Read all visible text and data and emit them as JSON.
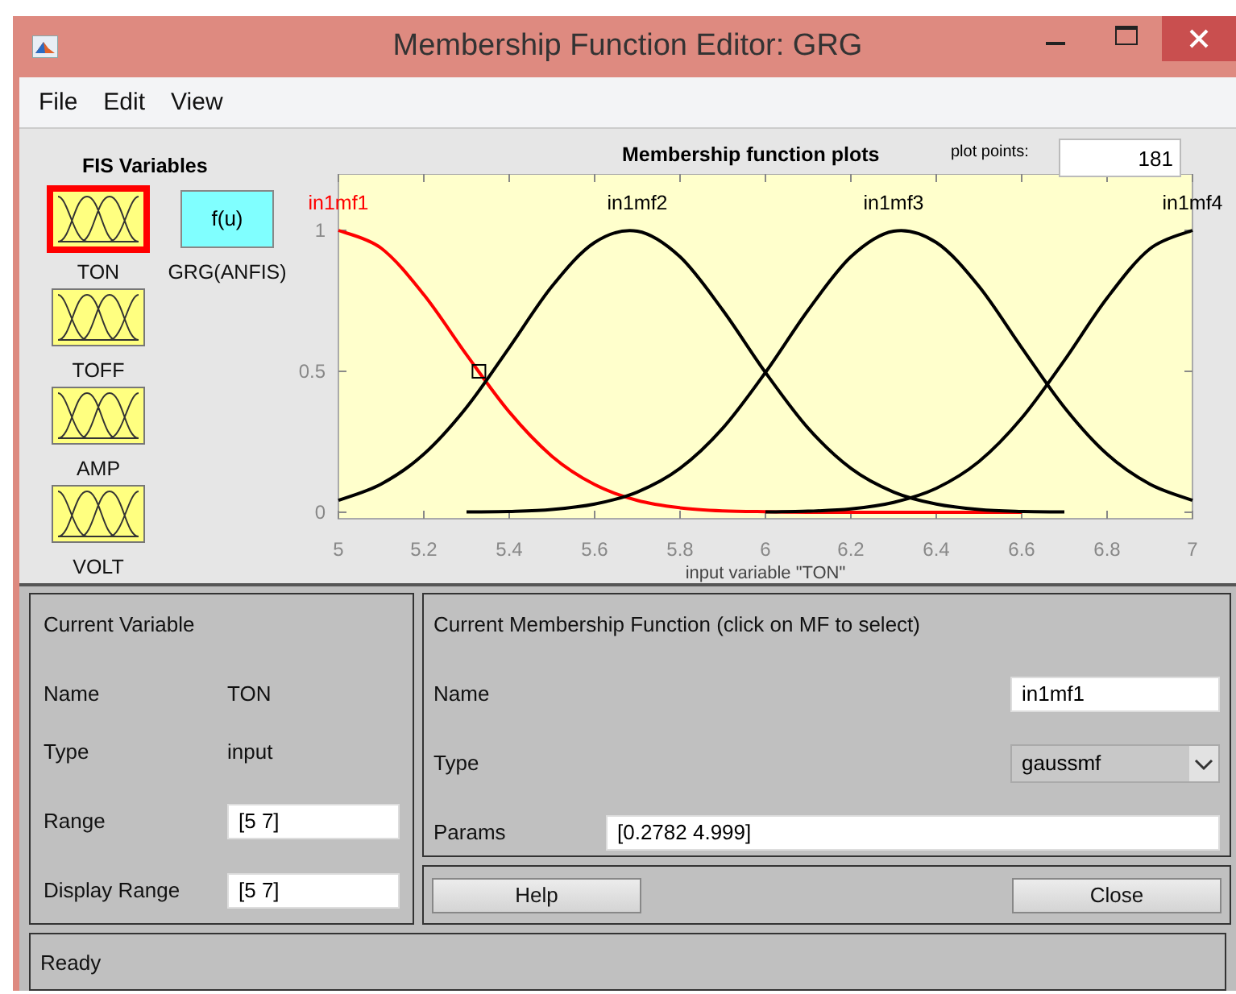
{
  "window": {
    "title": "Membership Function Editor: GRG"
  },
  "menu": [
    "File",
    "Edit",
    "View"
  ],
  "fis_variables": {
    "title": "FIS Variables",
    "items": [
      {
        "label": "TON",
        "kind": "input",
        "selected": true
      },
      {
        "label": "GRG(ANFIS)",
        "kind": "output",
        "selected": false,
        "tile_text": "f(u)"
      },
      {
        "label": "TOFF",
        "kind": "input",
        "selected": false
      },
      {
        "label": "AMP",
        "kind": "input",
        "selected": false
      },
      {
        "label": "VOLT",
        "kind": "input",
        "selected": false
      }
    ]
  },
  "plot": {
    "plot_points_label": "plot points:",
    "plot_points": "181",
    "chart_data": {
      "type": "line",
      "title": "Membership function plots",
      "xlabel": "input variable \"TON\"",
      "x": [
        5,
        5.1,
        5.2,
        5.3,
        5.4,
        5.5,
        5.6,
        5.7,
        5.8,
        5.9,
        6,
        6.1,
        6.2,
        6.3,
        6.4,
        6.5,
        6.6,
        6.7,
        6.8,
        6.9,
        7
      ],
      "series": [
        {
          "name": "in1mf1",
          "color": "#ff0000",
          "values": [
            1,
            0.937,
            0.772,
            0.559,
            0.356,
            0.199,
            0.098,
            0.042,
            0.016,
            0.005,
            0.002,
            0,
            0,
            0,
            0,
            0,
            0,
            null,
            null,
            null,
            null
          ]
        },
        {
          "name": "in1mf2",
          "color": "#000000",
          "values": [
            0.042,
            0.1,
            0.206,
            0.372,
            0.584,
            0.801,
            0.957,
            0.997,
            0.906,
            0.717,
            0.496,
            0.298,
            0.156,
            0.072,
            0.029,
            0.01,
            0.003,
            0.001,
            null,
            null,
            null
          ]
        },
        {
          "name": "in1mf3",
          "color": "#000000",
          "values": [
            null,
            null,
            null,
            0.001,
            0.003,
            0.01,
            0.029,
            0.072,
            0.156,
            0.298,
            0.496,
            0.717,
            0.906,
            0.997,
            0.957,
            0.801,
            0.584,
            0.372,
            0.206,
            0.1,
            0.042
          ]
        },
        {
          "name": "in1mf4",
          "color": "#000000",
          "values": [
            null,
            null,
            null,
            null,
            null,
            null,
            null,
            null,
            null,
            null,
            0.001,
            0.004,
            0.012,
            0.035,
            0.085,
            0.18,
            0.334,
            0.539,
            0.76,
            0.934,
            1
          ]
        }
      ],
      "xlim": [
        5,
        7
      ],
      "ylim": [
        -0.023,
        1.2
      ],
      "xticks": [
        5,
        5.2,
        5.4,
        5.6,
        5.8,
        6,
        6.2,
        6.4,
        6.6,
        6.8,
        7
      ],
      "yticks": [
        0,
        0.5,
        1
      ]
    }
  },
  "current_variable": {
    "title": "Current Variable",
    "fields": [
      {
        "label": "Name",
        "value": "TON",
        "kind": "text"
      },
      {
        "label": "Type",
        "value": "input",
        "kind": "text"
      },
      {
        "label": "Range",
        "value": "[5 7]",
        "kind": "input"
      },
      {
        "label": "Display Range",
        "value": "[5 7]",
        "kind": "input"
      }
    ]
  },
  "current_mf": {
    "title": "Current Membership Function (click on MF to select)",
    "name_label": "Name",
    "name": "in1mf1",
    "type_label": "Type",
    "type": "gaussmf",
    "params_label": "Params",
    "params": "[0.2782 4.999]"
  },
  "buttons": [
    "Help",
    "Close"
  ],
  "status": "Ready"
}
